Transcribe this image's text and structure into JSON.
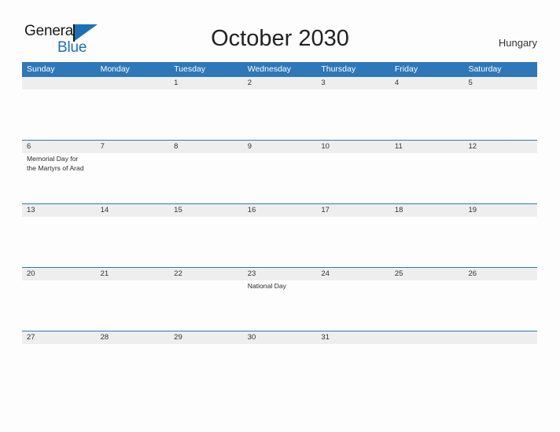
{
  "logo": {
    "word_one": "General",
    "word_two": "Blue",
    "flag_icon": "blue-flag-triangle",
    "accent_color": "#1a6fb5"
  },
  "header": {
    "title": "October 2030",
    "country": "Hungary"
  },
  "theme": {
    "header_blue": "#2e77b8",
    "row_band_gray": "#eeeeee",
    "page_background": "#fdfdfd",
    "text_color": "#333333"
  },
  "calendar": {
    "month": "October",
    "year": "2030",
    "day_headers": [
      "Sunday",
      "Monday",
      "Tuesday",
      "Wednesday",
      "Thursday",
      "Friday",
      "Saturday"
    ],
    "weeks": [
      {
        "days": [
          {
            "num": "",
            "event": ""
          },
          {
            "num": "",
            "event": ""
          },
          {
            "num": "1",
            "event": ""
          },
          {
            "num": "2",
            "event": ""
          },
          {
            "num": "3",
            "event": ""
          },
          {
            "num": "4",
            "event": ""
          },
          {
            "num": "5",
            "event": ""
          }
        ]
      },
      {
        "days": [
          {
            "num": "6",
            "event": "Memorial Day for the Martyrs of Arad"
          },
          {
            "num": "7",
            "event": ""
          },
          {
            "num": "8",
            "event": ""
          },
          {
            "num": "9",
            "event": ""
          },
          {
            "num": "10",
            "event": ""
          },
          {
            "num": "11",
            "event": ""
          },
          {
            "num": "12",
            "event": ""
          }
        ]
      },
      {
        "days": [
          {
            "num": "13",
            "event": ""
          },
          {
            "num": "14",
            "event": ""
          },
          {
            "num": "15",
            "event": ""
          },
          {
            "num": "16",
            "event": ""
          },
          {
            "num": "17",
            "event": ""
          },
          {
            "num": "18",
            "event": ""
          },
          {
            "num": "19",
            "event": ""
          }
        ]
      },
      {
        "days": [
          {
            "num": "20",
            "event": ""
          },
          {
            "num": "21",
            "event": ""
          },
          {
            "num": "22",
            "event": ""
          },
          {
            "num": "23",
            "event": "National Day"
          },
          {
            "num": "24",
            "event": ""
          },
          {
            "num": "25",
            "event": ""
          },
          {
            "num": "26",
            "event": ""
          }
        ]
      },
      {
        "days": [
          {
            "num": "27",
            "event": ""
          },
          {
            "num": "28",
            "event": ""
          },
          {
            "num": "29",
            "event": ""
          },
          {
            "num": "30",
            "event": ""
          },
          {
            "num": "31",
            "event": ""
          },
          {
            "num": "",
            "event": ""
          },
          {
            "num": "",
            "event": ""
          }
        ]
      }
    ]
  }
}
